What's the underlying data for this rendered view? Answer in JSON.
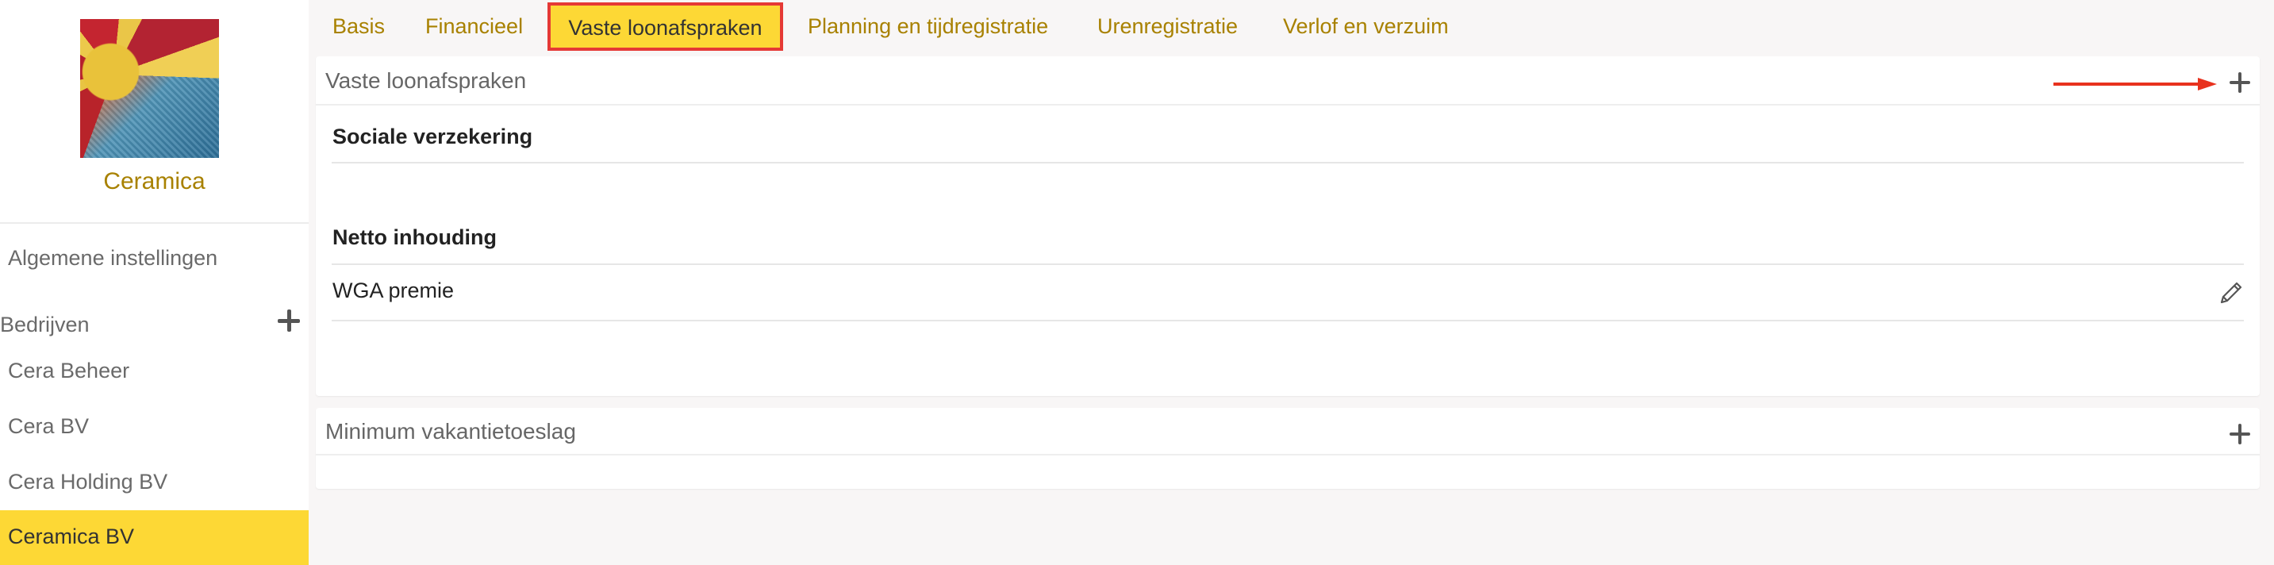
{
  "sidebar": {
    "company": "Ceramica",
    "general_settings": "Algemene instellingen",
    "companies_heading": "Bedrijven",
    "companies": [
      "Cera Beheer",
      "Cera BV",
      "Cera Holding BV"
    ],
    "active_company": "Ceramica BV"
  },
  "tabs": [
    {
      "label": "Basis"
    },
    {
      "label": "Financieel"
    },
    {
      "label": "Vaste loonafspraken"
    },
    {
      "label": "Planning en tijdregistratie"
    },
    {
      "label": "Urenregistratie"
    },
    {
      "label": "Verlof en verzuim"
    }
  ],
  "fixed_agreements": {
    "title": "Vaste loonafspraken",
    "social_insurance": "Sociale verzekering",
    "net_deduction": "Netto inhouding",
    "items": [
      {
        "name": "WGA premie"
      }
    ]
  },
  "min_holiday": {
    "title": "Minimum vakantietoeslag"
  },
  "colors": {
    "accent": "#fdd835",
    "link": "#a88100",
    "highlight_border": "#e53935",
    "arrow": "#e8321e"
  },
  "icons": [
    "plus-icon",
    "pencil-icon",
    "arrow-icon"
  ]
}
